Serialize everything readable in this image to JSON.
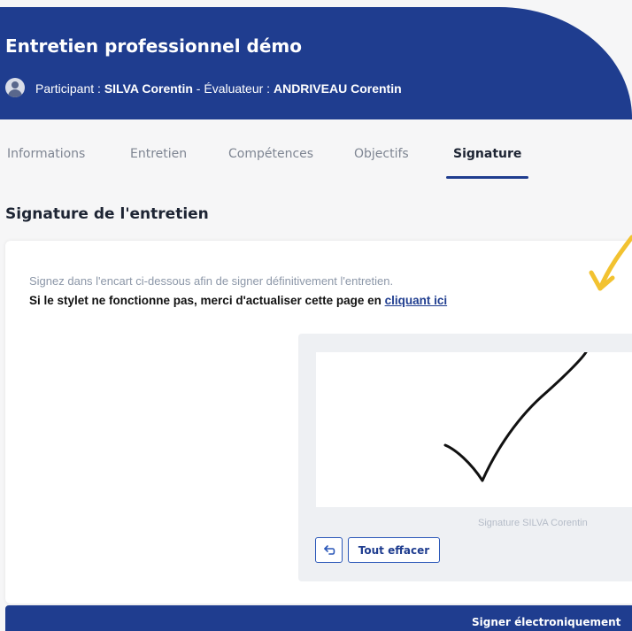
{
  "header": {
    "title": "Entretien professionnel démo",
    "participant_label": "Participant : ",
    "participant_name": "SILVA Corentin",
    "separator": " - ",
    "evaluator_label": "Évaluateur : ",
    "evaluator_name": "ANDRIVEAU Corentin"
  },
  "tabs": [
    {
      "label": "Informations",
      "active": false
    },
    {
      "label": "Entretien",
      "active": false
    },
    {
      "label": "Compétences",
      "active": false
    },
    {
      "label": "Objectifs",
      "active": false
    },
    {
      "label": "Signature",
      "active": true
    }
  ],
  "section": {
    "title": "Signature de l'entretien",
    "hint": "Signez dans l'encart ci-dessous afin de signer définitivement l'entretien.",
    "warning": "Si le stylet ne fonctionne pas, merci d'actualiser cette page en ",
    "warning_link": "cliquant ici"
  },
  "signature_pad": {
    "caption": "Signature SILVA Corentin",
    "undo_icon": "undo-arrow-icon",
    "clear_label": "Tout effacer"
  },
  "footer": {
    "sign_button_label": "Signer électroniquement"
  },
  "colors": {
    "brand": "#1f3d8f",
    "annotation_arrow": "#f2c230"
  }
}
